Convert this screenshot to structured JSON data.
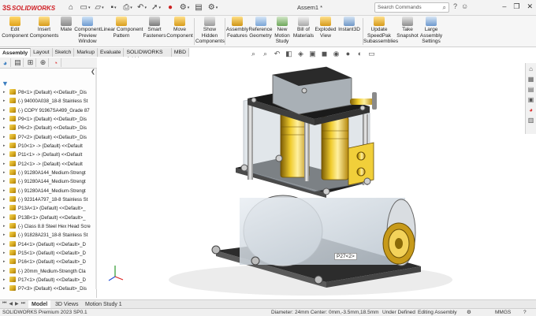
{
  "app": {
    "logo_text": "SOLIDWORKS",
    "document_title": "Assem1 *",
    "search_placeholder": "Search Commands"
  },
  "ribbon": {
    "buttons": [
      {
        "label": "Edit\nComponent"
      },
      {
        "label": "Insert\nComponents"
      },
      {
        "label": "Mate"
      },
      {
        "label": "Component\nPreview\nWindow"
      },
      {
        "label": "Linear Component\nPattern"
      },
      {
        "label": "Smart\nFasteners"
      },
      {
        "label": "Move\nComponent"
      },
      {
        "label": "Show\nHidden\nComponents"
      },
      {
        "label": "Assembly\nFeatures"
      },
      {
        "label": "Reference\nGeometry"
      },
      {
        "label": "New\nMotion\nStudy"
      },
      {
        "label": "Bill of\nMaterials"
      },
      {
        "label": "Exploded\nView"
      },
      {
        "label": "Instant3D"
      },
      {
        "label": "Update\nSpeedPak\nSubassemblies"
      },
      {
        "label": "Take\nSnapshot"
      },
      {
        "label": "Large\nAssembly\nSettings"
      }
    ]
  },
  "command_tabs": [
    "Assembly",
    "Layout",
    "Sketch",
    "Markup",
    "Evaluate",
    "SOLIDWORKS Add-Ins",
    "MBD"
  ],
  "tree": [
    "P8<1> (Default) <<Default>_Dis",
    "(-) 94000A038_18-8 Stainless St",
    "(-) COPY 91967SA499_Grade 87",
    "P9<1> (Default) <<Default>_Dis",
    "P6<2> (Default) <<Default>_Dis",
    "P7<2> (Default) <<Default>_Dis",
    "P10<1> -> (Default) <<Default",
    "P11<1> -> (Default) <<Default",
    "P12<1> -> (Default) <<Default",
    "(-) 91280A144_Medium-Strengt",
    "(-) 91280A144_Medium-Strengt",
    "(-) 91280A144_Medium-Strengt",
    "(-) 92314A797_18-8 Stainless St",
    "P13A<1> (Default) <<Default>_",
    "P13B<1> (Default) <<Default>_",
    "(-) Class 8.8 Steel Hex Head Scre",
    "(-) 91828A231_18-8 Stainless St",
    "P14<1> (Default) <<Default>_D",
    "P15<1> (Default) <<Default>_D",
    "P16<1> (Default) <<Default>_D",
    "(-) 20mm_Medium-Strength Cla",
    "P17<1> (Default) <<Default>_D",
    "P7<3> (Default) <<Default>_Dis"
  ],
  "callout": "P27<2>",
  "bottom_tabs": [
    "Model",
    "3D Views",
    "Motion Study 1"
  ],
  "status": {
    "product": "SOLIDWORKS Premium 2023 SP0.1",
    "measurement": "Diameter: 24mm  Center: 0mm,-3.5mm,18.5mm",
    "state": "Under Defined",
    "mode": "Editing Assembly",
    "units": "MMGS"
  },
  "colors": {
    "brand_red": "#d01f25",
    "accent_blue": "#3b7dbf",
    "part_yellow": "#e3be25"
  }
}
